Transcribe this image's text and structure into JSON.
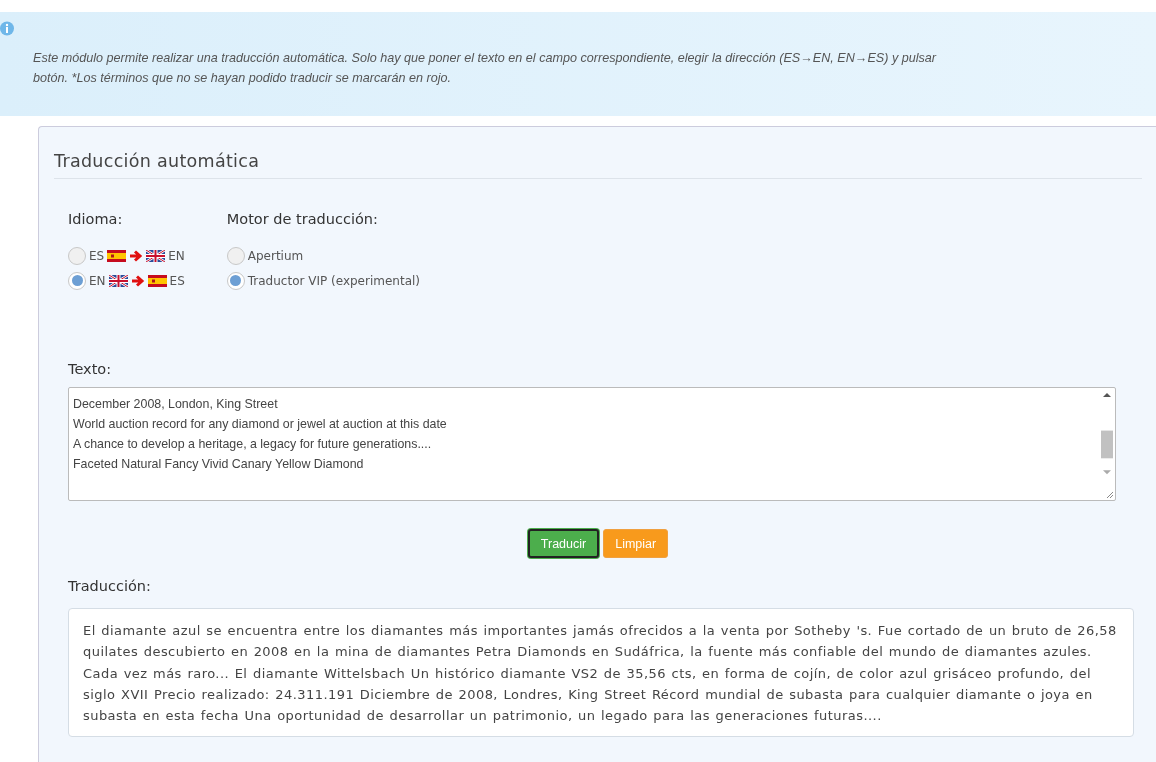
{
  "info": {
    "lines": [
      "Este módulo permite realizar una traducción automática. Solo hay que poner el texto en el campo correspondiente, elegir la dirección (ES→EN, EN→ES) y pulsar",
      "botón. *Los términos que no se hayan podido traducir se marcarán en rojo."
    ]
  },
  "card": {
    "title": "Traducción automática"
  },
  "language": {
    "label": "Idioma:",
    "options": [
      {
        "kind": "forward",
        "from": "ES",
        "to": "EN",
        "selected": false
      },
      {
        "kind": "backward",
        "from": "EN",
        "to": "ES",
        "selected": true
      }
    ]
  },
  "engine": {
    "label": "Motor de traducción:",
    "options": [
      {
        "label": "Apertium",
        "selected": false
      },
      {
        "label": "Traductor VIP (experimental)",
        "selected": true
      }
    ]
  },
  "input": {
    "label": "Texto:",
    "lines": [
      "December 2008, London, King Street",
      "World auction record for any diamond or jewel at auction at this date",
      "A chance to develop a heritage, a legacy for future generations....",
      "Faceted Natural Fancy Vivid Canary Yellow Diamond"
    ]
  },
  "buttons": [
    {
      "label": "Traducir",
      "kind": "primary"
    },
    {
      "label": "Limpiar",
      "kind": "warning"
    }
  ],
  "output": {
    "label": "Traducción:",
    "text": "El diamante azul se encuentra entre los diamantes más importantes jamás ofrecidos a la venta por Sotheby 's. Fue cortado de un bruto de 26,58 quilates descubierto en 2008 en la mina de diamantes Petra Diamonds en Sudáfrica, la fuente más confiable del mundo de diamantes azules. Cada vez más raro... El diamante Wittelsbach Un histórico diamante VS2 de 35,56 cts, en forma de cojín, de color azul grisáceo profundo, del siglo XVII Precio realizado: 24.311.191 Diciembre de 2008, Londres, King Street Récord mundial de subasta para cualquier diamante o joya en subasta en esta fecha Una oportunidad de desarrollar un patrimonio, un legado para las generaciones futuras...."
  }
}
